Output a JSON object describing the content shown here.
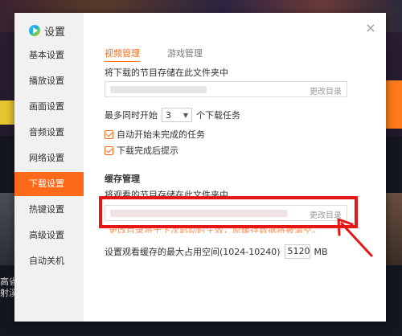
{
  "background": {
    "left_text": "高省\n射溪"
  },
  "dialog": {
    "title": "设置",
    "close_glyph": "×",
    "sidebar": {
      "items": [
        {
          "label": "基本设置",
          "active": false
        },
        {
          "label": "播放设置",
          "active": false
        },
        {
          "label": "画面设置",
          "active": false
        },
        {
          "label": "音频设置",
          "active": false
        },
        {
          "label": "网络设置",
          "active": false
        },
        {
          "label": "下载设置",
          "active": true
        },
        {
          "label": "热键设置",
          "active": false
        },
        {
          "label": "高级设置",
          "active": false
        },
        {
          "label": "自动关机",
          "active": false
        }
      ]
    },
    "tabs": [
      {
        "label": "视频管理",
        "active": true
      },
      {
        "label": "游戏管理",
        "active": false
      }
    ],
    "download": {
      "folder_label": "将下载的节目存储在此文件夹中",
      "change_dir_label": "更改目录",
      "max_prefix": "最多同时开始",
      "max_value": "3",
      "max_suffix": "个下载任务",
      "auto_start_label": "自动开始未完成的任务",
      "auto_start_checked": true,
      "notify_label": "下载完成后提示",
      "notify_checked": true
    },
    "cache": {
      "section_title": "缓存管理",
      "folder_label": "将观看的节目存储在此文件夹中",
      "change_dir_label": "更改目录",
      "warning_text": "更改目录将于下次启动时生效，原缓存数据将被清空。",
      "max_space_label": "设置观看缓存的最大占用空间(1024-10240)",
      "max_space_value": "5120",
      "unit": "MB"
    }
  },
  "colors": {
    "accent": "#ff6a1a",
    "annotation": "#e51616"
  }
}
